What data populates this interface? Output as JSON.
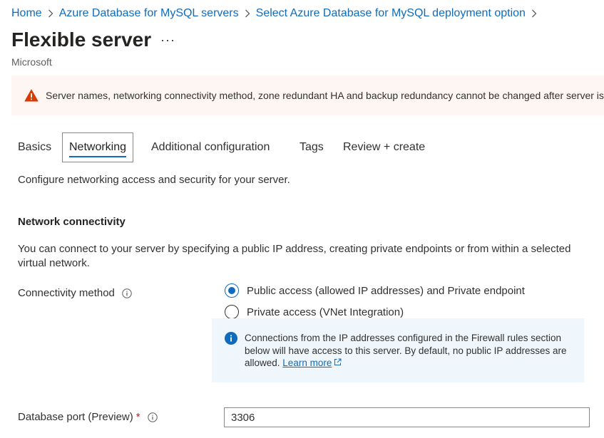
{
  "breadcrumb": [
    "Home",
    "Azure Database for MySQL servers",
    "Select Azure Database for MySQL deployment option"
  ],
  "page": {
    "title": "Flexible server",
    "more_label": "···",
    "subtitle": "Microsoft"
  },
  "warning": {
    "icon": "warning-icon",
    "color": "#d83b01",
    "text": "Server names, networking connectivity method, zone redundant HA and backup redundancy cannot be changed after server is c"
  },
  "tabs": [
    {
      "label": "Basics",
      "active": false
    },
    {
      "label": "Networking",
      "active": true
    },
    {
      "label": "Additional configuration",
      "active": false
    },
    {
      "label": "Tags",
      "active": false
    },
    {
      "label": "Review + create",
      "active": false
    }
  ],
  "description": "Configure networking access and security for your server.",
  "network": {
    "heading": "Network connectivity",
    "paragraph": "You can connect to your server by specifying a public IP address, creating private endpoints or from within a selected virtual network.",
    "method_label": "Connectivity method",
    "options": [
      {
        "label": "Public access (allowed IP addresses) and Private endpoint",
        "selected": true
      },
      {
        "label": "Private access (VNet Integration)",
        "selected": false
      }
    ],
    "info": {
      "text": "Connections from the IP addresses configured in the Firewall rules section below will have access to this server. By default, no public IP addresses are allowed.",
      "link": "Learn more"
    }
  },
  "port": {
    "label": "Database port (Preview)",
    "required_mark": "*",
    "value": "3306"
  },
  "colors": {
    "accent": "#0f6cbd",
    "required": "#a4262c",
    "info_bg": "#eff6fc",
    "warning_bg": "#fdf6f3"
  }
}
